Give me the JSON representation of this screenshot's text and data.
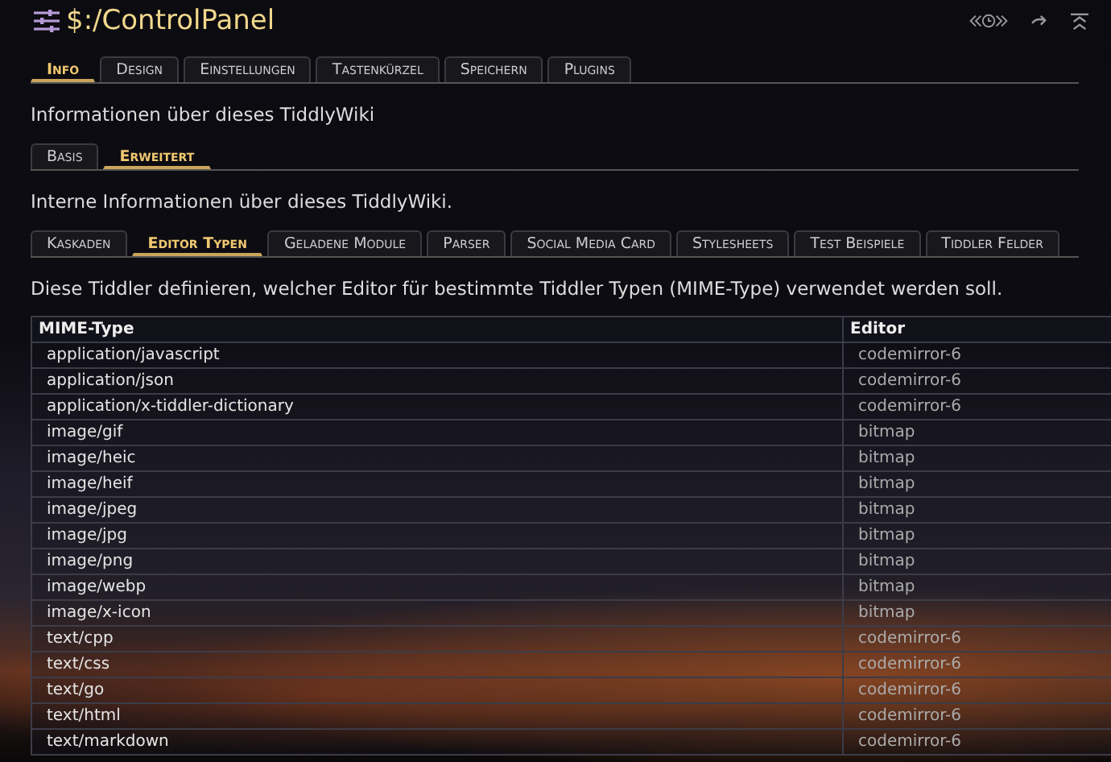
{
  "title": "$:/ControlPanel",
  "main_tabs": [
    {
      "label": "Info",
      "selected": true
    },
    {
      "label": "Design",
      "selected": false
    },
    {
      "label": "Einstellungen",
      "selected": false
    },
    {
      "label": "Tastenkürzel",
      "selected": false
    },
    {
      "label": "Speichern",
      "selected": false
    },
    {
      "label": "Plugins",
      "selected": false
    }
  ],
  "info_heading": "Informationen über dieses TiddlyWiki",
  "sub_tabs": [
    {
      "label": "Basis",
      "selected": false
    },
    {
      "label": "Erweitert",
      "selected": true
    }
  ],
  "advanced_heading": "Interne Informationen über dieses TiddlyWiki.",
  "advanced_tabs": [
    {
      "label": "Kaskaden",
      "selected": false
    },
    {
      "label": "Editor Typen",
      "selected": true
    },
    {
      "label": "Geladene Module",
      "selected": false
    },
    {
      "label": "Parser",
      "selected": false
    },
    {
      "label": "Social Media Card",
      "selected": false
    },
    {
      "label": "Stylesheets",
      "selected": false
    },
    {
      "label": "Test Beispiele",
      "selected": false
    },
    {
      "label": "Tiddler Felder",
      "selected": false
    }
  ],
  "description": "Diese Tiddler definieren, welcher Editor für bestimmte Tiddler Typen (MIME-Type) verwendet werden soll.",
  "table": {
    "columns": [
      "MIME-Type",
      "Editor"
    ],
    "rows": [
      [
        "application/javascript",
        "codemirror-6"
      ],
      [
        "application/json",
        "codemirror-6"
      ],
      [
        "application/x-tiddler-dictionary",
        "codemirror-6"
      ],
      [
        "image/gif",
        "bitmap"
      ],
      [
        "image/heic",
        "bitmap"
      ],
      [
        "image/heif",
        "bitmap"
      ],
      [
        "image/jpeg",
        "bitmap"
      ],
      [
        "image/jpg",
        "bitmap"
      ],
      [
        "image/png",
        "bitmap"
      ],
      [
        "image/webp",
        "bitmap"
      ],
      [
        "image/x-icon",
        "bitmap"
      ],
      [
        "text/cpp",
        "codemirror-6"
      ],
      [
        "text/css",
        "codemirror-6"
      ],
      [
        "text/go",
        "codemirror-6"
      ],
      [
        "text/html",
        "codemirror-6"
      ],
      [
        "text/markdown",
        "codemirror-6"
      ]
    ]
  }
}
